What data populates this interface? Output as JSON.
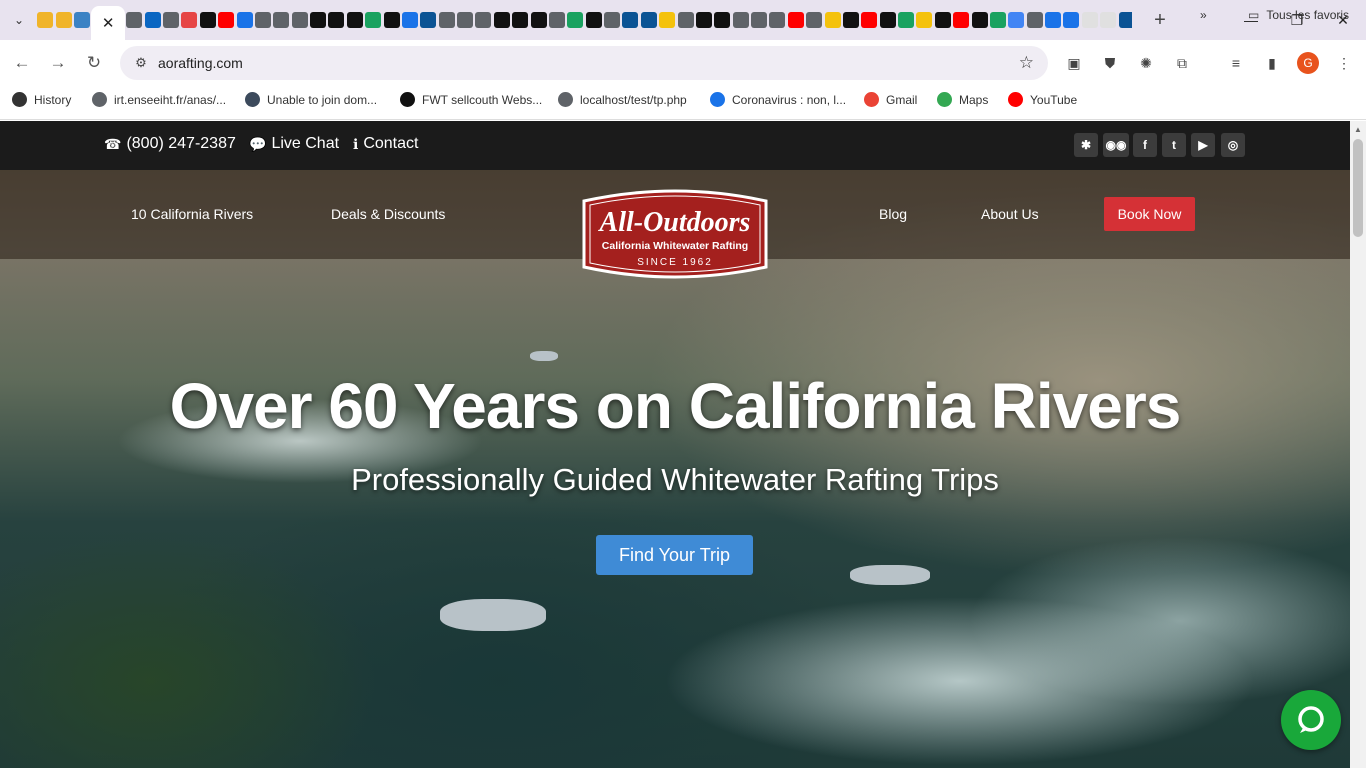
{
  "browser": {
    "url": "aorafting.com",
    "active_tab_close": "✕",
    "new_tab": "+",
    "pinned_tab_colors": [
      "#f0b429",
      "#f0b429",
      "#3b82c4",
      "#5f6368",
      "#0a66c2",
      "#5f6368",
      "#e64545",
      "#111111",
      "#ff0000",
      "#1a73e8",
      "#5f6368",
      "#5f6368",
      "#5f6368",
      "#111111",
      "#111111",
      "#111111",
      "#1aa260",
      "#111111",
      "#1a73e8",
      "#0b5394",
      "#5f6368",
      "#5f6368",
      "#5f6368",
      "#111111",
      "#111111",
      "#111111",
      "#5f6368",
      "#1aa260",
      "#111111",
      "#5f6368",
      "#0b5394",
      "#0b5394",
      "#f4c20d",
      "#5f6368",
      "#111111",
      "#111111",
      "#5f6368",
      "#5f6368",
      "#5f6368",
      "#ff0000",
      "#5f6368",
      "#f4c20d",
      "#111111",
      "#ff0000",
      "#111111",
      "#1aa260",
      "#f4c20d",
      "#111111",
      "#ff0000",
      "#111111",
      "#1aa260",
      "#4285f4",
      "#5f6368",
      "#1a73e8",
      "#1a73e8",
      "#e0e0e0",
      "#e0e0e0",
      "#0b5394",
      "#5f6368",
      "#ff8a00",
      "#1a73e8",
      "#5f6368",
      "#1a73e8",
      "#5f6368"
    ]
  },
  "bookmarks": [
    {
      "label": "History",
      "color": "#333333"
    },
    {
      "label": "irt.enseeiht.fr/anas/...",
      "color": "#5f6368"
    },
    {
      "label": "Unable to join dom...",
      "color": "#3c4a5c"
    },
    {
      "label": "FWT sellcouth Webs...",
      "color": "#111111"
    },
    {
      "label": "localhost/test/tp.php",
      "color": "#5f6368"
    },
    {
      "label": "Coronavirus : non, l...",
      "color": "#1a73e8"
    },
    {
      "label": "Gmail",
      "color": "#ea4335"
    },
    {
      "label": "Maps",
      "color": "#34a853"
    },
    {
      "label": "YouTube",
      "color": "#ff0000"
    }
  ],
  "bookmarks_more": "»",
  "all_bookmarks": "Tous les favoris",
  "profile_initial": "G",
  "site": {
    "phone": "(800) 247-2387",
    "live_chat": "Live Chat",
    "contact": "Contact",
    "nav": {
      "rivers": "10 California Rivers",
      "deals": "Deals & Discounts",
      "blog": "Blog",
      "about": "About Us",
      "book": "Book Now"
    },
    "logo": {
      "name": "All-Outdoors",
      "tagline": "California Whitewater Rafting",
      "since": "SINCE 1962"
    },
    "headline": "Over 60 Years on California Rivers",
    "subhead": "Professionally Guided Whitewater Rafting Trips",
    "cta": "Find Your Trip",
    "social_icons": [
      "yelp-icon",
      "tripadvisor-icon",
      "facebook-icon",
      "twitter-icon",
      "youtube-icon",
      "instagram-icon"
    ]
  },
  "colors": {
    "book_button": "#d53136",
    "cta_button": "#3f8bd6",
    "chat_button": "#19a83a",
    "topbar": "#1b1b1b"
  }
}
